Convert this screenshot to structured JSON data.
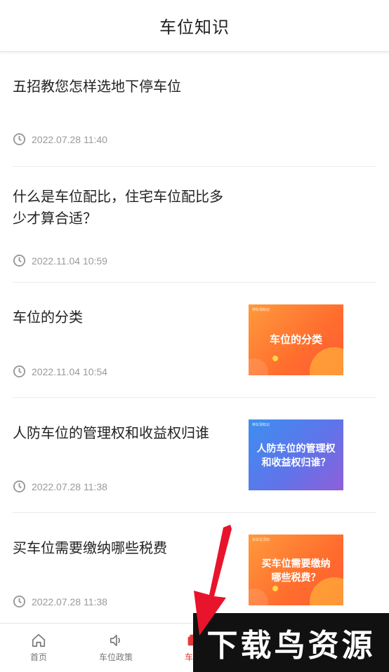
{
  "header": {
    "title": "车位知识"
  },
  "articles": [
    {
      "title": "五招教您怎样选地下停车位",
      "date": "2022.07.28 11:40"
    },
    {
      "title": "什么是车位配比，住宅车位配比多少才算合适？",
      "date": "2022.11.04 10:59"
    },
    {
      "title": "车位的分类",
      "date": "2022.11.04 10:54",
      "thumb": {
        "tag": "停车场知识",
        "text": "车位的分类",
        "color": "#ff7a2f"
      }
    },
    {
      "title": "人防车位的管理权和收益权归谁",
      "date": "2022.07.28 11:38",
      "thumb": {
        "tag": "停车场知识",
        "text": "人防车位的管理权和收益权归谁？",
        "color": "#5a7de8"
      }
    },
    {
      "title": "买车位需要缴纳哪些税费",
      "date": "2022.07.28 11:38",
      "thumb": {
        "tag": "买车位须知",
        "text": "买车位需要缴纳哪些税费？",
        "color": "#ff7a2f"
      }
    }
  ],
  "nav": {
    "items": [
      {
        "label": "首页",
        "icon": "home-icon"
      },
      {
        "label": "车位政策",
        "icon": "speaker-icon"
      },
      {
        "label": "车位",
        "icon": "knowledge-icon",
        "active": true
      }
    ]
  },
  "watermark": {
    "text": "下载鸟资源"
  },
  "colors": {
    "accent": "#e53935",
    "arrow": "#e8142b"
  }
}
